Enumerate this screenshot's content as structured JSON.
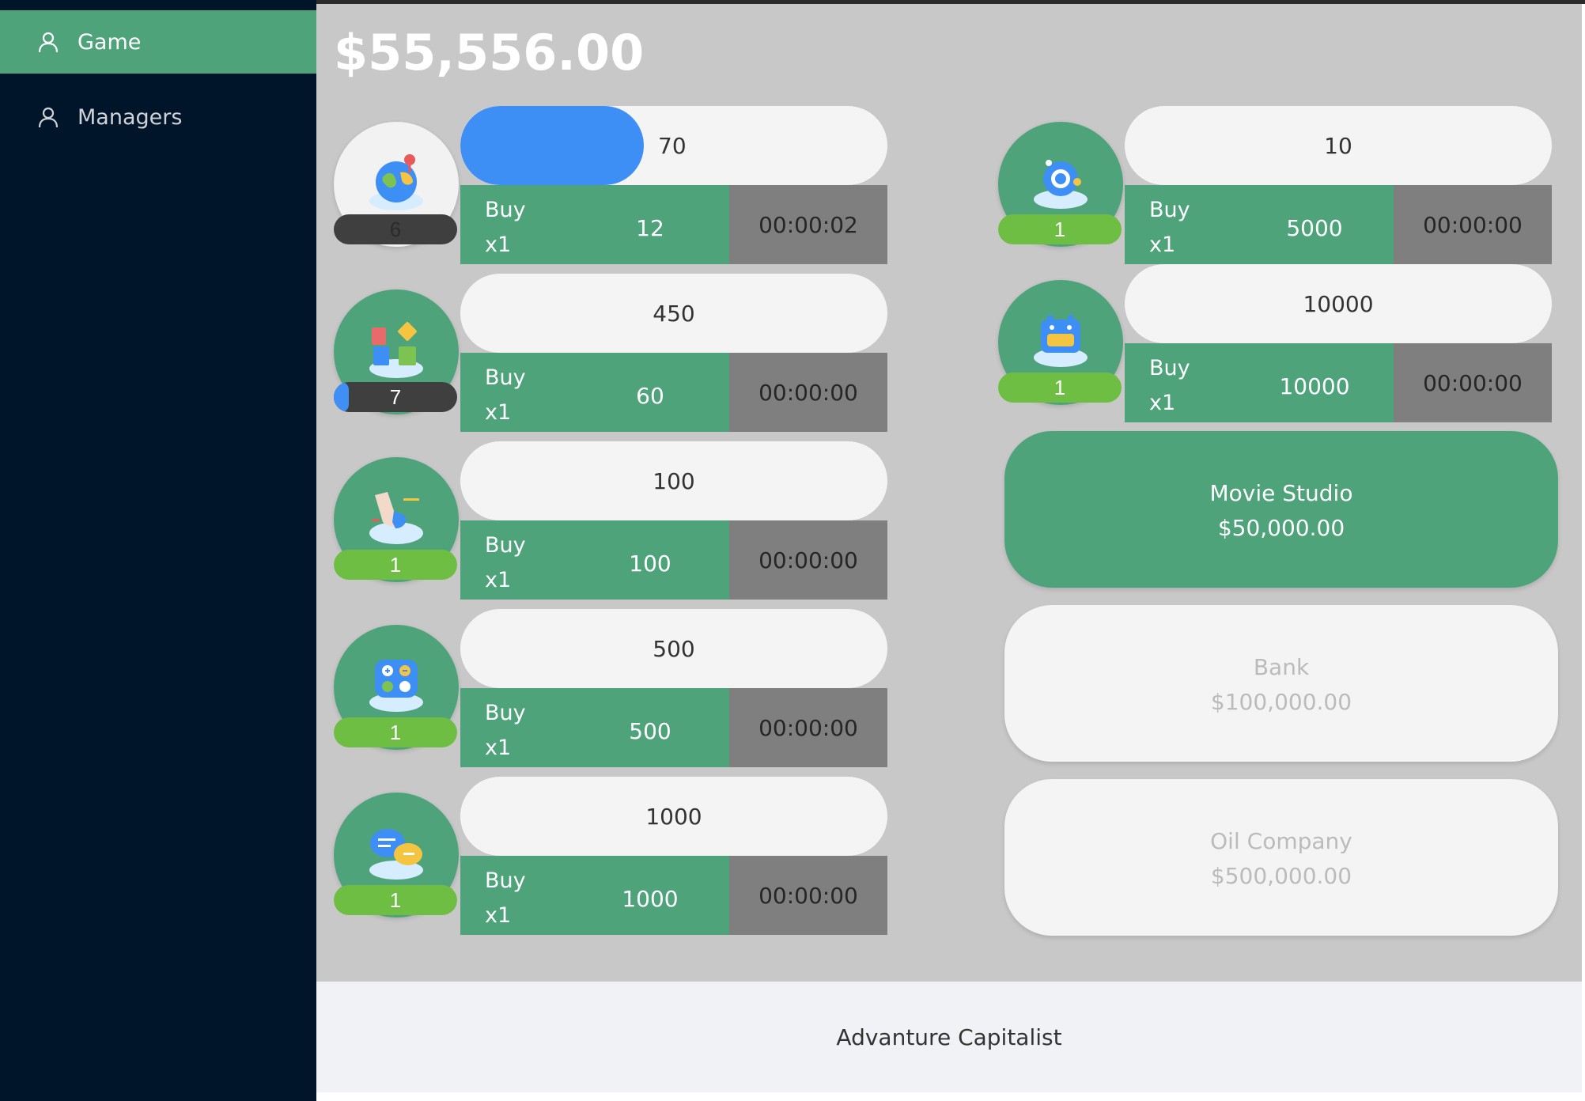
{
  "sidebar": {
    "items": [
      {
        "label": "Game",
        "icon": "user-icon",
        "active": true
      },
      {
        "label": "Managers",
        "icon": "user-icon",
        "active": false
      }
    ]
  },
  "header": {
    "money": "$55,556.00"
  },
  "businesses": [
    {
      "icon": "globe-pin-icon",
      "progress_value": "70",
      "progress_fraction": 0.43,
      "quantity": "6",
      "buy_label": "Buy",
      "multiplier": "x1",
      "cost": "12",
      "timer": "00:00:02"
    },
    {
      "icon": "books-icon",
      "progress_value": "450",
      "progress_fraction": 0.0,
      "quantity": "7",
      "quantity_fill_fraction": 0.12,
      "buy_label": "Buy",
      "multiplier": "x1",
      "cost": "60",
      "timer": "00:00:00"
    },
    {
      "icon": "sneaker-icon",
      "progress_value": "100",
      "progress_fraction": 0.0,
      "quantity": "1",
      "buy_label": "Buy",
      "multiplier": "x1",
      "cost": "100",
      "timer": "00:00:00"
    },
    {
      "icon": "calculator-icon",
      "progress_value": "500",
      "progress_fraction": 0.0,
      "quantity": "1",
      "buy_label": "Buy",
      "multiplier": "x1",
      "cost": "500",
      "timer": "00:00:00"
    },
    {
      "icon": "chat-bubbles-icon",
      "progress_value": "1000",
      "progress_fraction": 0.0,
      "quantity": "1",
      "buy_label": "Buy",
      "multiplier": "x1",
      "cost": "1000",
      "timer": "00:00:00"
    },
    {
      "icon": "planet-icon",
      "progress_value": "10",
      "progress_fraction": 0.0,
      "quantity": "1",
      "buy_label": "Buy",
      "multiplier": "x1",
      "cost": "5000",
      "timer": "00:00:00"
    },
    {
      "icon": "robot-icon",
      "progress_value": "10000",
      "progress_fraction": 0.0,
      "quantity": "1",
      "buy_label": "Buy",
      "multiplier": "x1",
      "cost": "10000",
      "timer": "00:00:00"
    }
  ],
  "unlocks": [
    {
      "name": "Movie Studio",
      "price": "$50,000.00",
      "available": true
    },
    {
      "name": "Bank",
      "price": "$100,000.00",
      "available": false
    },
    {
      "name": "Oil Company",
      "price": "$500,000.00",
      "available": false
    }
  ],
  "footer": {
    "text": "Advanture Capitalist"
  },
  "colors": {
    "sidebar_bg": "#001529",
    "accent_green": "#4ea37b",
    "progress_blue": "#3d8ff5",
    "quantity_green": "#6fbe44",
    "timer_gray": "#7f7f7f",
    "main_bg": "#c8c8c8"
  }
}
